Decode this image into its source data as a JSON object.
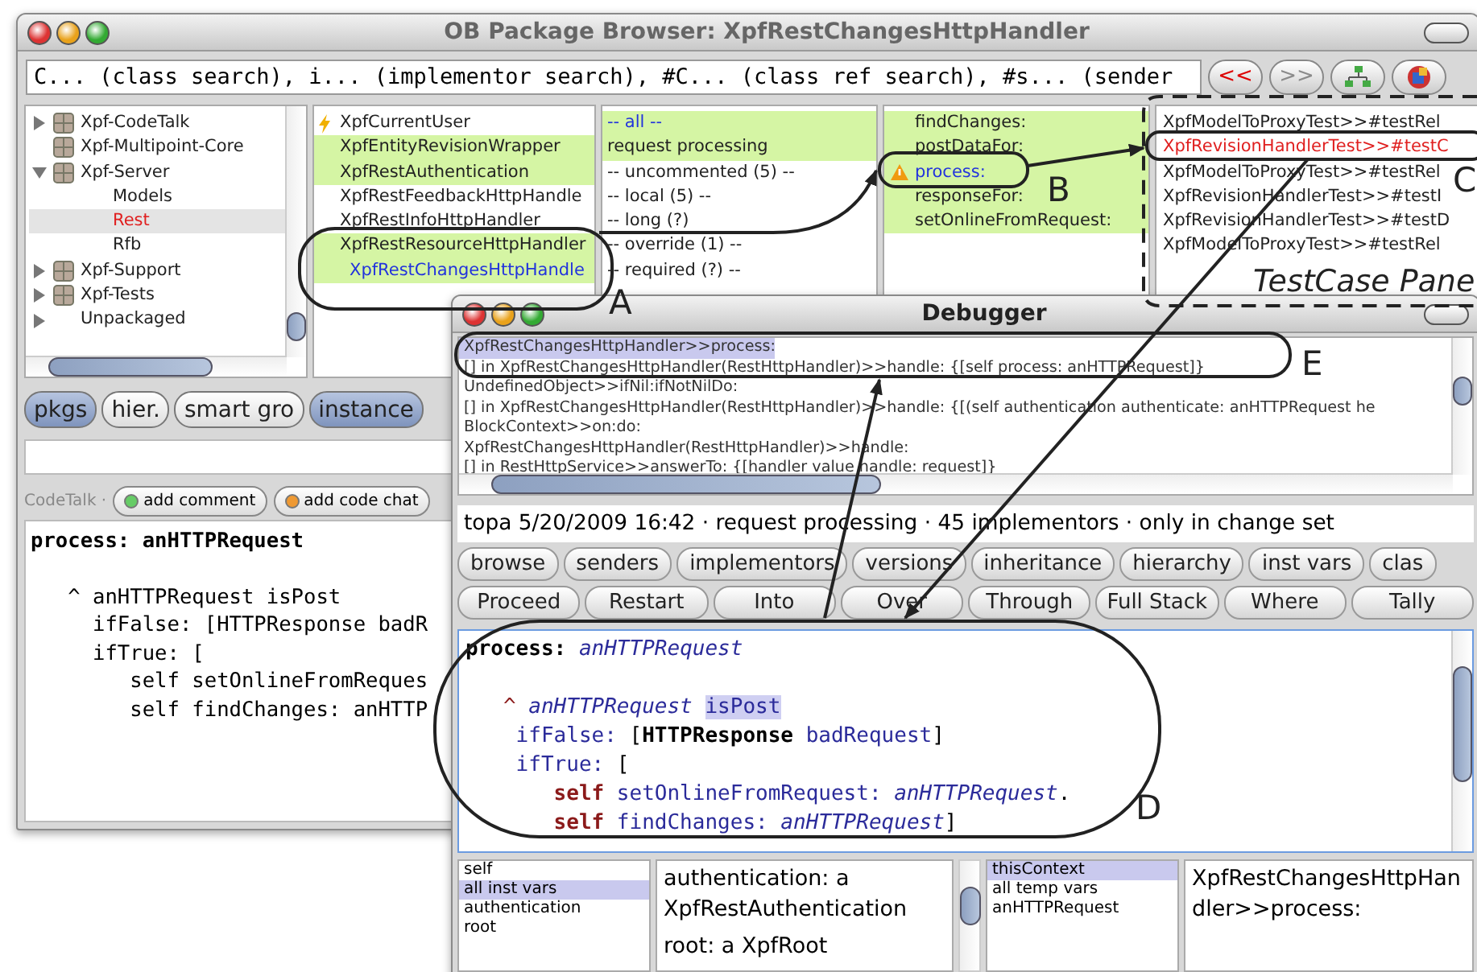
{
  "browser": {
    "title": "OB Package Browser: XpfRestChangesHttpHandler",
    "search": {
      "value": "C... (class search), i... (implementor search), #C... (class ref search), #s... (sender"
    },
    "nav_buttons": [
      {
        "label": "<<",
        "disabled": false
      },
      {
        "label": ">>",
        "disabled": true
      }
    ],
    "packages": [
      {
        "name": "Xpf-CodeTalk",
        "expanded": false,
        "package_icon": true,
        "selected": false
      },
      {
        "name": "Xpf-Multipoint-Core",
        "package_icon": true,
        "selected": false
      },
      {
        "name": "Xpf-Server",
        "expanded": true,
        "package_icon": true,
        "selected": false,
        "children": [
          {
            "name": "Models",
            "package_icon": false,
            "selected": false
          },
          {
            "name": "Rest",
            "package_icon": false,
            "selected": true
          },
          {
            "name": "Rfb",
            "package_icon": false,
            "selected": false
          }
        ]
      },
      {
        "name": "Xpf-Support",
        "expanded": false,
        "package_icon": true,
        "selected": false
      },
      {
        "name": "Xpf-Tests",
        "expanded": false,
        "package_icon": true,
        "selected": false
      },
      {
        "name": "Unpackaged",
        "expanded": false,
        "package_icon": false,
        "selected": false
      }
    ],
    "classes": [
      {
        "name": "XpfCurrentUser",
        "highlighted": false,
        "selected": false
      },
      {
        "name": "XpfEntityRevisionWrapper",
        "highlighted": true,
        "selected": false
      },
      {
        "name": "XpfRestAuthentication",
        "highlighted": true,
        "selected": false
      },
      {
        "name": "XpfRestFeedbackHttpHandle",
        "highlighted": false,
        "selected": false
      },
      {
        "name": "XpfRestInfoHttpHandler",
        "highlighted": false,
        "selected": false
      },
      {
        "name": "XpfRestResourceHttpHandler",
        "highlighted": true,
        "selected": false,
        "children": [
          {
            "name": "XpfRestChangesHttpHandle",
            "highlighted": true,
            "selected": true
          }
        ]
      }
    ],
    "categories": [
      {
        "name": "-- all --",
        "highlighted": true,
        "selected": true
      },
      {
        "name": "request processing",
        "highlighted": true,
        "selected": false
      },
      {
        "name": "-- uncommented (5) --",
        "highlighted": false,
        "selected": false
      },
      {
        "name": "-- local (5) --",
        "highlighted": false,
        "selected": false
      },
      {
        "name": "-- long (?)",
        "highlighted": false,
        "selected": false
      },
      {
        "name": "-- override (1) --",
        "highlighted": false,
        "selected": false
      },
      {
        "name": "-- required (?) --",
        "highlighted": false,
        "selected": false
      }
    ],
    "methods": [
      {
        "name": "findChanges:",
        "highlighted": true,
        "selected": false
      },
      {
        "name": "postDataFor:",
        "highlighted": true,
        "selected": false
      },
      {
        "name": "process:",
        "highlighted": true,
        "selected": true
      },
      {
        "name": "responseFor:",
        "highlighted": true,
        "selected": false
      },
      {
        "name": "setOnlineFromRequest:",
        "highlighted": true,
        "selected": false
      }
    ],
    "tests": [
      {
        "name": "XpfModelToProxyTest>>#testRel",
        "failed": false
      },
      {
        "name": "XpfRevisionHandlerTest>>#testC",
        "failed": true
      },
      {
        "name": "XpfModelToProxyTest>>#testRel",
        "failed": false
      },
      {
        "name": "XpfRevisionHandlerTest>>#testI",
        "failed": false
      },
      {
        "name": "XpfRevisionHandlerTest>>#testD",
        "failed": false
      },
      {
        "name": "XpfModelToProxyTest>>#testRel",
        "failed": false
      }
    ],
    "mode_buttons": [
      {
        "label": "pkgs",
        "selected": true
      },
      {
        "label": "hier.",
        "selected": false
      },
      {
        "label": "smart gro",
        "selected": false
      },
      {
        "label": "instance",
        "selected": true
      }
    ],
    "codetalk": {
      "label": "CodeTalk ·",
      "buttons": [
        "add comment",
        "add code chat"
      ]
    },
    "code": [
      {
        "text": "process: anHTTPRequest",
        "bold": true
      },
      {
        "text": "   ^ anHTTPRequest isPost",
        "blank_before": true
      },
      {
        "text": "     ifFalse: [HTTPResponse badR"
      },
      {
        "text": "     ifTrue: ["
      },
      {
        "text": "        self setOnlineFromReques"
      },
      {
        "text": "        self findChanges: anHTTP"
      }
    ]
  },
  "debugger": {
    "title": "Debugger",
    "stack": [
      {
        "text": "XpfRestChangesHttpHandler>>process:",
        "selected": true
      },
      {
        "text": "[] in XpfRestChangesHttpHandler(RestHttpHandler)>>handle: {[self process: anHTTPRequest]}",
        "selected": false
      },
      {
        "text": "UndefinedObject>>ifNil:ifNotNilDo:",
        "selected": false
      },
      {
        "text": "[] in XpfRestChangesHttpHandler(RestHttpHandler)>>handle: {[(self authentication authenticate: anHTTPRequest he",
        "selected": false
      },
      {
        "text": "BlockContext>>on:do:",
        "selected": false
      },
      {
        "text": "XpfRestChangesHttpHandler(RestHttpHandler)>>handle:",
        "selected": false
      },
      {
        "text": "[] in RestHttpService>>answerTo: {[handler value handle: request]}",
        "selected": false
      }
    ],
    "status": "topa 5/20/2009 16:42 · request processing · 45 implementors · only in change set",
    "tool_buttons": [
      "browse",
      "senders",
      "implementors",
      "versions",
      "inheritance",
      "hierarchy",
      "inst vars",
      "clas"
    ],
    "step_buttons": [
      "Proceed",
      "Restart",
      "Into",
      "Over",
      "Through",
      "Full Stack",
      "Where",
      "Tally"
    ],
    "code": [
      {
        "tokens": [
          {
            "t": "process: ",
            "kind": "decl"
          },
          {
            "t": "anHTTPRequest",
            "kind": "arg"
          }
        ]
      },
      {
        "blank_before": true,
        "tokens": [
          {
            "t": "   ^ ",
            "kind": "caret"
          },
          {
            "t": "anHTTPRequest ",
            "kind": "arg"
          },
          {
            "t": "isPost",
            "kind": "current"
          }
        ]
      },
      {
        "tokens": [
          {
            "t": "    ifFalse: ",
            "kind": "message"
          },
          {
            "t": "[",
            "kind": "punct"
          },
          {
            "t": "HTTPResponse ",
            "kind": "bold"
          },
          {
            "t": "badRequest",
            "kind": "message"
          },
          {
            "t": "]",
            "kind": "punct"
          }
        ]
      },
      {
        "tokens": [
          {
            "t": "    ifTrue: ",
            "kind": "message"
          },
          {
            "t": "[",
            "kind": "punct"
          }
        ]
      },
      {
        "tokens": [
          {
            "t": "       self ",
            "kind": "pseudo"
          },
          {
            "t": "setOnlineFromRequest: ",
            "kind": "message"
          },
          {
            "t": "anHTTPRequest",
            "kind": "arg"
          },
          {
            "t": ".",
            "kind": "punct"
          }
        ]
      },
      {
        "tokens": [
          {
            "t": "       self ",
            "kind": "pseudo"
          },
          {
            "t": "findChanges: ",
            "kind": "message"
          },
          {
            "t": "anHTTPRequest",
            "kind": "arg"
          },
          {
            "t": "]",
            "kind": "punct"
          }
        ]
      }
    ],
    "receiver_fields": [
      {
        "name": "self",
        "selected": false
      },
      {
        "name": "all inst vars",
        "selected": true
      },
      {
        "name": "authentication",
        "selected": false
      },
      {
        "name": "root",
        "selected": false
      }
    ],
    "receiver_value": [
      "authentication:    a XpfRestAuthentication",
      "root:    a XpfRoot"
    ],
    "context_fields": [
      {
        "name": "thisContext",
        "selected": true
      },
      {
        "name": "all temp vars",
        "selected": false
      },
      {
        "name": "anHTTPRequest",
        "selected": false
      }
    ],
    "context_value": "XpfRestChangesHttpHandler>>process:"
  },
  "annotations": {
    "labels": [
      "A",
      "B",
      "C",
      "D",
      "E"
    ],
    "pane_caption": "TestCase Pane"
  }
}
